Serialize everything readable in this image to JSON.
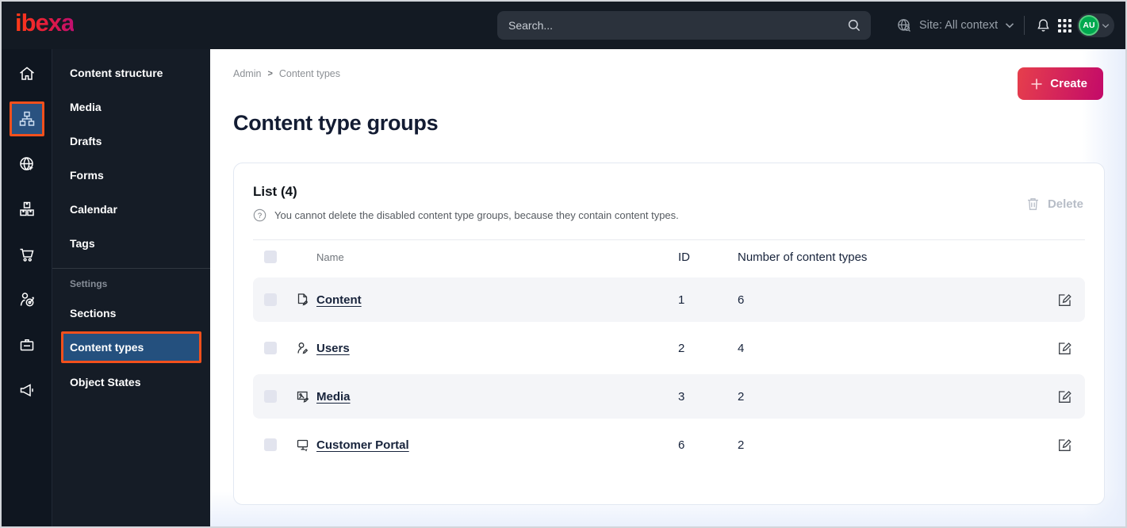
{
  "topbar": {
    "logo_text": "ibexa",
    "search": {
      "placeholder": "Search..."
    },
    "site_selector": {
      "label": "Site: All context"
    },
    "avatar": {
      "initials": "AU"
    },
    "icons": [
      "globe-search-icon",
      "bell-icon",
      "app-grid-icon",
      "chevron-down-icon"
    ]
  },
  "rail": {
    "items": [
      {
        "name": "dashboard",
        "icon": "home-icon",
        "active": false
      },
      {
        "name": "content",
        "icon": "sitemap-icon",
        "active": true
      },
      {
        "name": "site",
        "icon": "globe-cursor-icon",
        "active": false
      },
      {
        "name": "product-catalog",
        "icon": "packages-icon",
        "active": false
      },
      {
        "name": "commerce",
        "icon": "cart-icon",
        "active": false
      },
      {
        "name": "personalization",
        "icon": "person-target-icon",
        "active": false
      },
      {
        "name": "admin",
        "icon": "badge-icon",
        "active": false
      },
      {
        "name": "marketing",
        "icon": "megaphone-icon",
        "active": false
      }
    ]
  },
  "sidebar": {
    "items": [
      {
        "label": "Content structure",
        "active": false
      },
      {
        "label": "Media",
        "active": false
      },
      {
        "label": "Drafts",
        "active": false
      },
      {
        "label": "Forms",
        "active": false
      },
      {
        "label": "Calendar",
        "active": false
      },
      {
        "label": "Tags",
        "active": false
      }
    ],
    "section_label": "Settings",
    "section_items": [
      {
        "label": "Sections",
        "active": false
      },
      {
        "label": "Content types",
        "active": true
      },
      {
        "label": "Object States",
        "active": false
      }
    ]
  },
  "main": {
    "breadcrumb": {
      "items": [
        "Admin",
        "Content types"
      ],
      "separator": ">"
    },
    "create_button": "Create",
    "title": "Content type groups",
    "list_card": {
      "title": "List (4)",
      "info": "You cannot delete the disabled content type groups, because they contain content types.",
      "delete_button": "Delete",
      "columns": {
        "name": "Name",
        "id": "ID",
        "count": "Number of content types"
      },
      "rows": [
        {
          "icon": "file-icon",
          "name": "Content",
          "id": "1",
          "count": "6"
        },
        {
          "icon": "user-icon",
          "name": "Users",
          "id": "2",
          "count": "4"
        },
        {
          "icon": "image-icon",
          "name": "Media",
          "id": "3",
          "count": "2"
        },
        {
          "icon": "monitor-icon",
          "name": "Customer Portal",
          "id": "6",
          "count": "2"
        }
      ]
    }
  },
  "colors": {
    "topbar_bg": "#131a23",
    "rail_bg": "#0f1620",
    "menu_bg": "#151c26",
    "accent_orange": "#f2501c",
    "active_blue": "#2a5280",
    "create_gradient_start": "#e63f4c",
    "create_gradient_end": "#c30a69",
    "avatar_green": "#00a94f",
    "row_stripe": "#f4f5f8",
    "link_color": "#18243c",
    "page_edge_blue": "#e9effc"
  }
}
